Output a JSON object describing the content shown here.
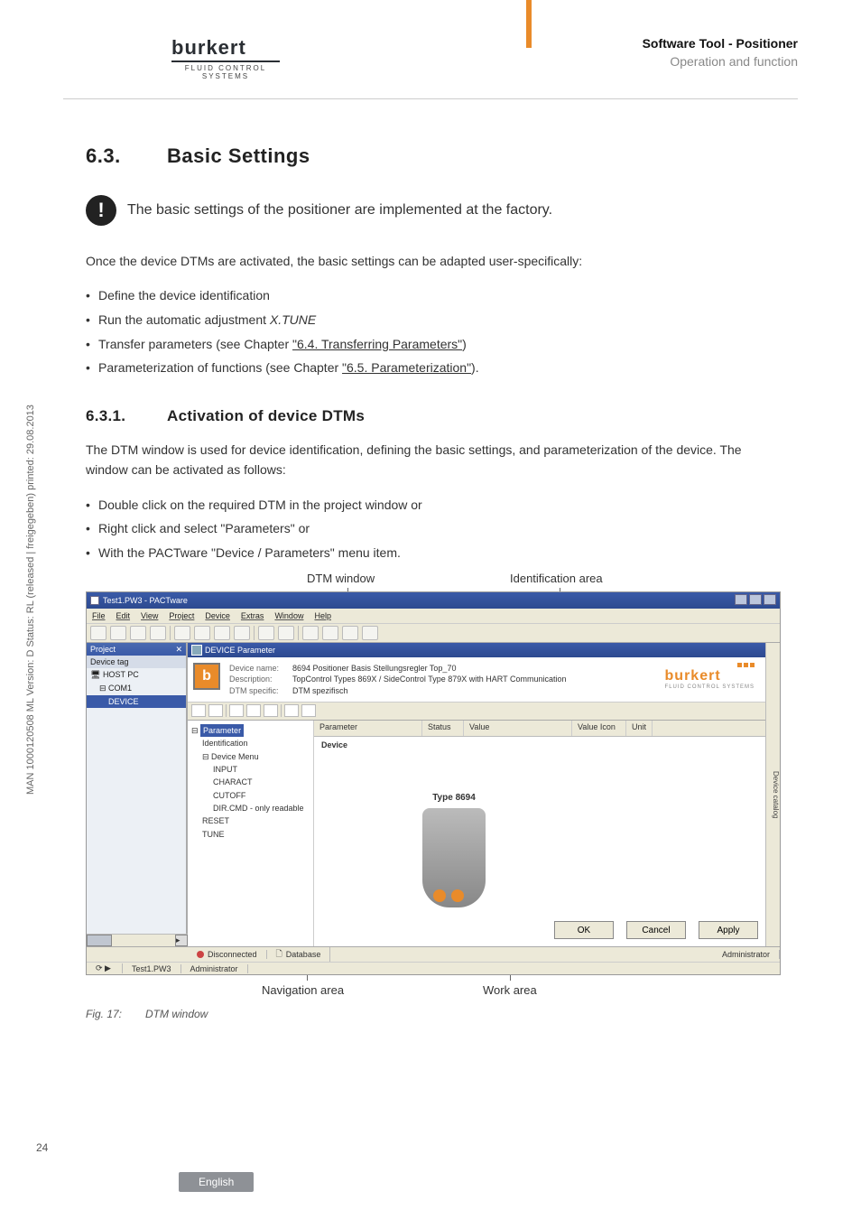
{
  "header": {
    "title_bold": "Software Tool - Positioner",
    "title_sub": "Operation and function",
    "brand": "burkert",
    "brand_sub": "FLUID CONTROL SYSTEMS"
  },
  "section": {
    "num": "6.3.",
    "title": "Basic Settings",
    "note": "The basic settings of the positioner are implemented at the factory.",
    "intro": "Once the device DTMs are activated, the basic settings can be adapted user-specifically:",
    "bullets": {
      "b1": "Define the device identification",
      "b2a": "Run the automatic adjustment ",
      "b2b": "X.TUNE",
      "b3a": "Transfer parameters (see Chapter ",
      "b3b": "\"6.4. Transferring Parameters\"",
      "b3c": ")",
      "b4a": "Parameterization of functions (see Chapter ",
      "b4b": "\"6.5. Parameterization\"",
      "b4c": ")."
    }
  },
  "subsection": {
    "num": "6.3.1.",
    "title": "Activation of device DTMs",
    "p1": "The DTM window is used for device identification, defining the basic settings, and parameterization of the device. The window can be activated as follows:",
    "bullets": {
      "b1": "Double click on the required DTM in the project window or",
      "b2": "Right click and select \"Parameters\" or",
      "b3": "With the PACTware \"Device / Parameters\" menu item."
    }
  },
  "figure": {
    "top_l1": "DTM window",
    "top_l2": "Identification area",
    "bot_l1": "Navigation area",
    "bot_l2": "Work area",
    "caption_num": "Fig. 17:",
    "caption_text": "DTM window"
  },
  "screenshot": {
    "window_title": "Test1.PW3 - PACTware",
    "menus": [
      "File",
      "Edit",
      "View",
      "Project",
      "Device",
      "Extras",
      "Window",
      "Help"
    ],
    "project_panel": {
      "header": "Project",
      "col": "Device tag",
      "rows": [
        "HOST PC",
        "COM1",
        "DEVICE"
      ]
    },
    "dtm": {
      "title": "DEVICE Parameter",
      "ident": {
        "name_lbl": "Device name:",
        "name_val": "8694 Positioner Basis Stellungsregler Top_70",
        "desc_lbl": "Description:",
        "desc_val": "TopControl Types 869X / SideControl Type 879X  with HART Communication",
        "spec_lbl": "DTM specific:",
        "spec_val": "DTM spezifisch",
        "brand": "burkert",
        "brand_sub": "FLUID CONTROL SYSTEMS",
        "vtab": "Device catalog"
      },
      "tree": {
        "root": "Parameter",
        "n1": "Identification",
        "n2": "Device Menu",
        "n2a": "INPUT",
        "n2b": "CHARACT",
        "n2c": "CUTOFF",
        "n2d": "DIR.CMD - only readable",
        "n3": "RESET",
        "n4": "TUNE"
      },
      "work_headers": [
        "Parameter",
        "Status",
        "Value",
        "Value Icon",
        "Unit"
      ],
      "work_device": "Device",
      "product_label": "Type 8694",
      "buttons": {
        "ok": "OK",
        "cancel": "Cancel",
        "apply": "Apply"
      }
    },
    "statusbar": {
      "s1": "Disconnected",
      "s2": "Database",
      "s3": "Administrator",
      "s4": "Test1.PW3",
      "s5": "Administrator"
    }
  },
  "side_text": "MAN  1000120508  ML  Version: D  Status: RL (released | freigegeben)  printed: 29.08.2013",
  "page_num": "24",
  "footer": "English"
}
